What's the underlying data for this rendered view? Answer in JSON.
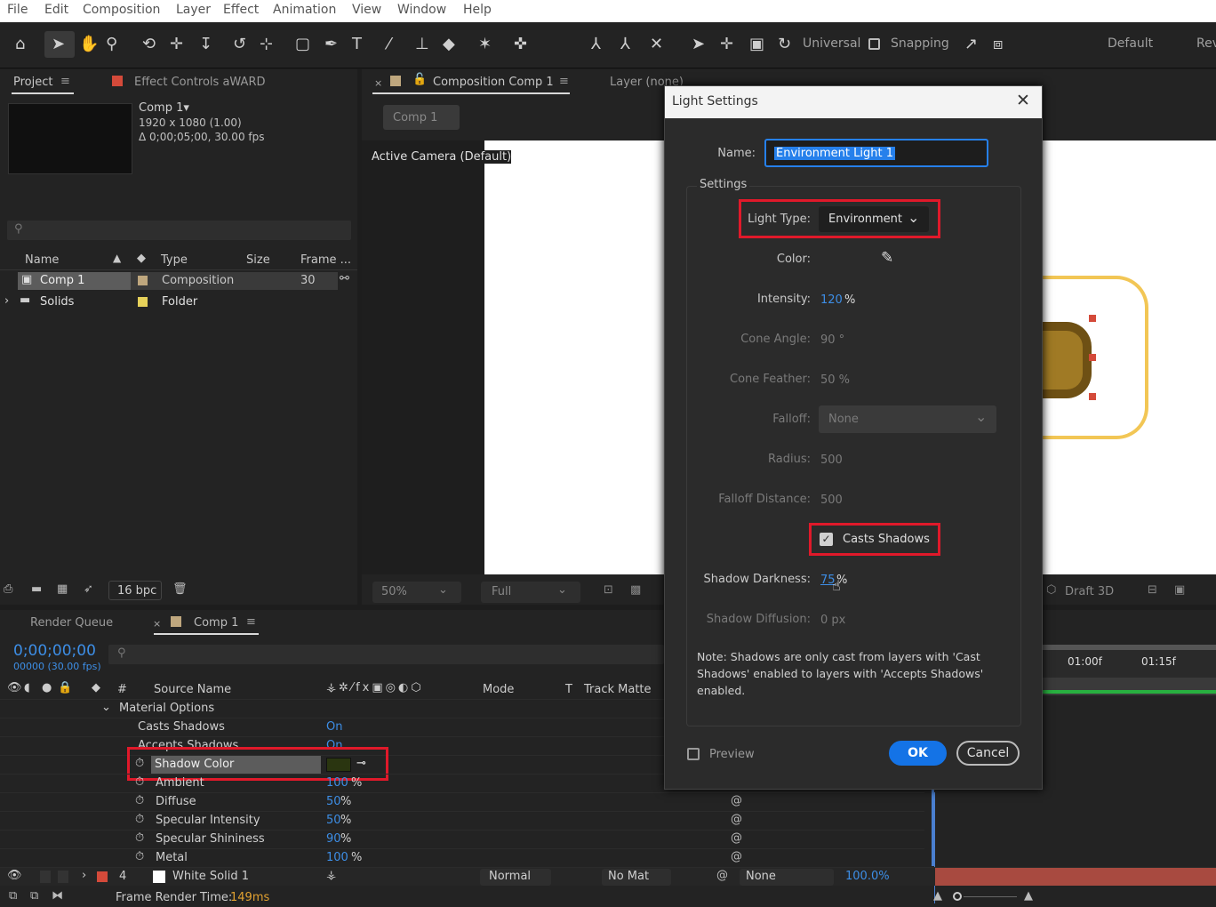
{
  "menu": [
    "File",
    "Edit",
    "Composition",
    "Layer",
    "Effect",
    "Animation",
    "View",
    "Window",
    "Help"
  ],
  "toolbar": {
    "universal": "Universal",
    "snapping": "Snapping",
    "workspace_default": "Default",
    "workspace_rev": "Rev"
  },
  "project": {
    "tab_project": "Project",
    "tab_effect_controls": "Effect Controls aWARD",
    "comp_name": "Comp 1▾",
    "comp_res": "1920 x 1080 (1.00)",
    "comp_dur": "Δ 0;00;05;00, 30.00 fps",
    "col_name": "Name",
    "col_type": "Type",
    "col_size": "Size",
    "col_frame": "Frame ...",
    "items": [
      {
        "name": "Comp 1",
        "type": "Composition",
        "frame": "30",
        "color": "#bfa77e"
      },
      {
        "name": "Solids",
        "type": "Folder",
        "frame": "",
        "color": "#e6d15a"
      }
    ],
    "bpc": "16 bpc"
  },
  "viewer": {
    "tab_comp": "Composition Comp 1",
    "tab_layer": "Layer (none)",
    "breadcrumb": "Comp 1",
    "camera": "Active Camera (Default)",
    "zoom": "50%",
    "resolution": "Full",
    "renderer": "Draft 3D"
  },
  "timeline": {
    "tab_render": "Render Queue",
    "tab_comp": "Comp 1",
    "timecode": "0;00;00;00",
    "frame_info": "00000 (30.00 fps)",
    "col_num": "#",
    "col_source": "Source Name",
    "col_mode": "Mode",
    "col_t": "T",
    "col_track": "Track Matte",
    "ruler": [
      "01:00f",
      "01:15f"
    ],
    "group": "Material Options",
    "props": [
      {
        "name": "Casts Shadows",
        "value": "On",
        "unit": ""
      },
      {
        "name": "Accepts Shadows",
        "value": "On",
        "unit": ""
      },
      {
        "name": "Shadow Color",
        "value": "",
        "unit": ""
      },
      {
        "name": "Ambient",
        "value": "100",
        "unit": "%"
      },
      {
        "name": "Diffuse",
        "value": "50",
        "unit": "%"
      },
      {
        "name": "Specular Intensity",
        "value": "50",
        "unit": "%"
      },
      {
        "name": "Specular Shininess",
        "value": "90",
        "unit": "%"
      },
      {
        "name": "Metal",
        "value": "100",
        "unit": "%"
      }
    ],
    "layer": {
      "num": "4",
      "name": "White Solid 1",
      "mode": "Normal",
      "matte": "No Mat",
      "parent": "None",
      "stretch": "100.0%"
    },
    "render_label": "Frame Render Time:",
    "render_time": "149ms"
  },
  "dialog": {
    "title": "Light Settings",
    "name_label": "Name:",
    "name_value": "Environment Light 1",
    "settings_label": "Settings",
    "light_type_label": "Light Type:",
    "light_type_value": "Environment",
    "color_label": "Color:",
    "intensity_label": "Intensity:",
    "intensity_value": "120",
    "intensity_unit": "%",
    "cone_angle_label": "Cone Angle:",
    "cone_angle_value": "90 °",
    "cone_feather_label": "Cone Feather:",
    "cone_feather_value": "50 %",
    "falloff_label": "Falloff:",
    "falloff_value": "None",
    "radius_label": "Radius:",
    "radius_value": "500",
    "falloff_dist_label": "Falloff Distance:",
    "falloff_dist_value": "500",
    "casts_shadows": "Casts Shadows",
    "shadow_darkness_label": "Shadow Darkness:",
    "shadow_darkness_value": "75",
    "shadow_darkness_unit": "%",
    "shadow_diffusion_label": "Shadow Diffusion:",
    "shadow_diffusion_value": "0 px",
    "note": "Note: Shadows are only cast from layers with 'Cast Shadows' enabled to layers with 'Accepts Shadows' enabled.",
    "preview": "Preview",
    "ok": "OK",
    "cancel": "Cancel"
  },
  "colors": {
    "accent": "#1473e6",
    "highlight": "#e0192a",
    "timecode": "#3d8ee6",
    "shadow_swatch": "#2a3510"
  }
}
